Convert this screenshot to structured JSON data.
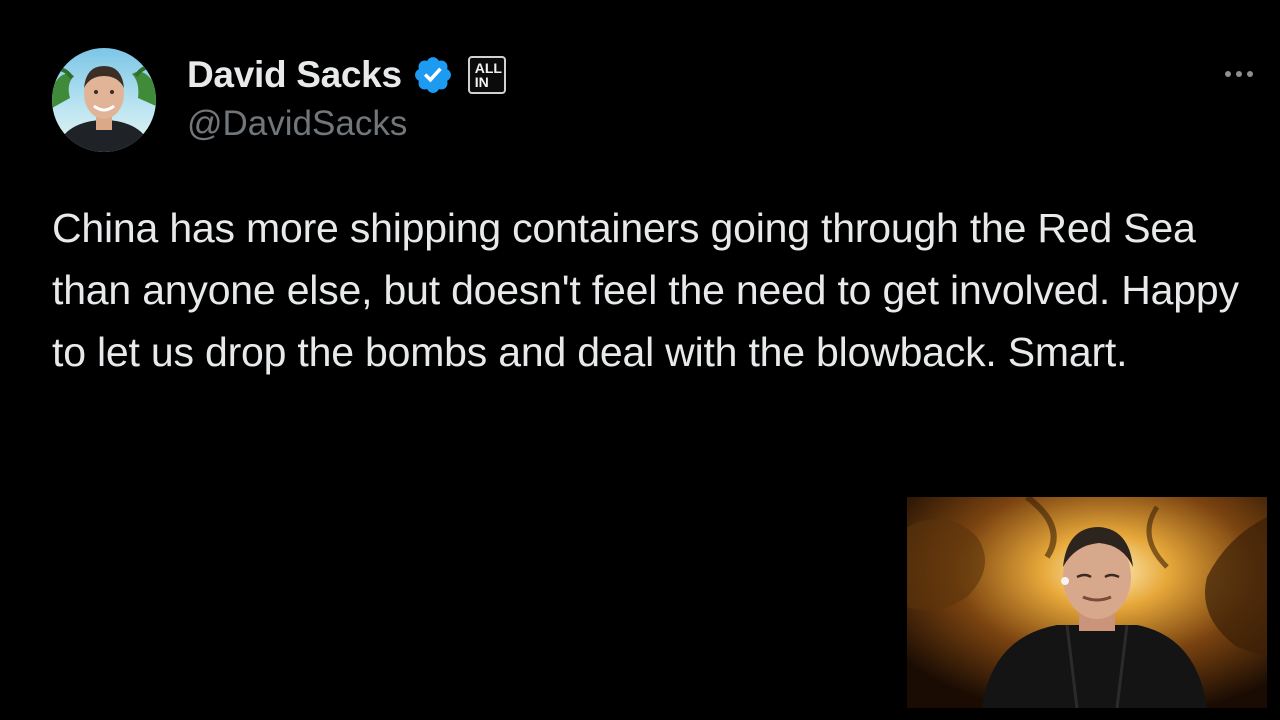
{
  "tweet": {
    "author": {
      "display_name": "David Sacks",
      "handle": "@DavidSacks",
      "verified": true,
      "affiliate_badge": {
        "line1": "ALL",
        "line2": "IN"
      }
    },
    "text": "China has more shipping containers going through the Red Sea than anyone else, but doesn't feel the need to get involved. Happy to let us drop the bombs and deal with the blowback. Smart.",
    "more_icon": "more-horizontal-icon"
  },
  "colors": {
    "background": "#000000",
    "primary_text": "#e7e9ea",
    "secondary_text": "#71767b",
    "verified_blue": "#1d9bf0"
  }
}
